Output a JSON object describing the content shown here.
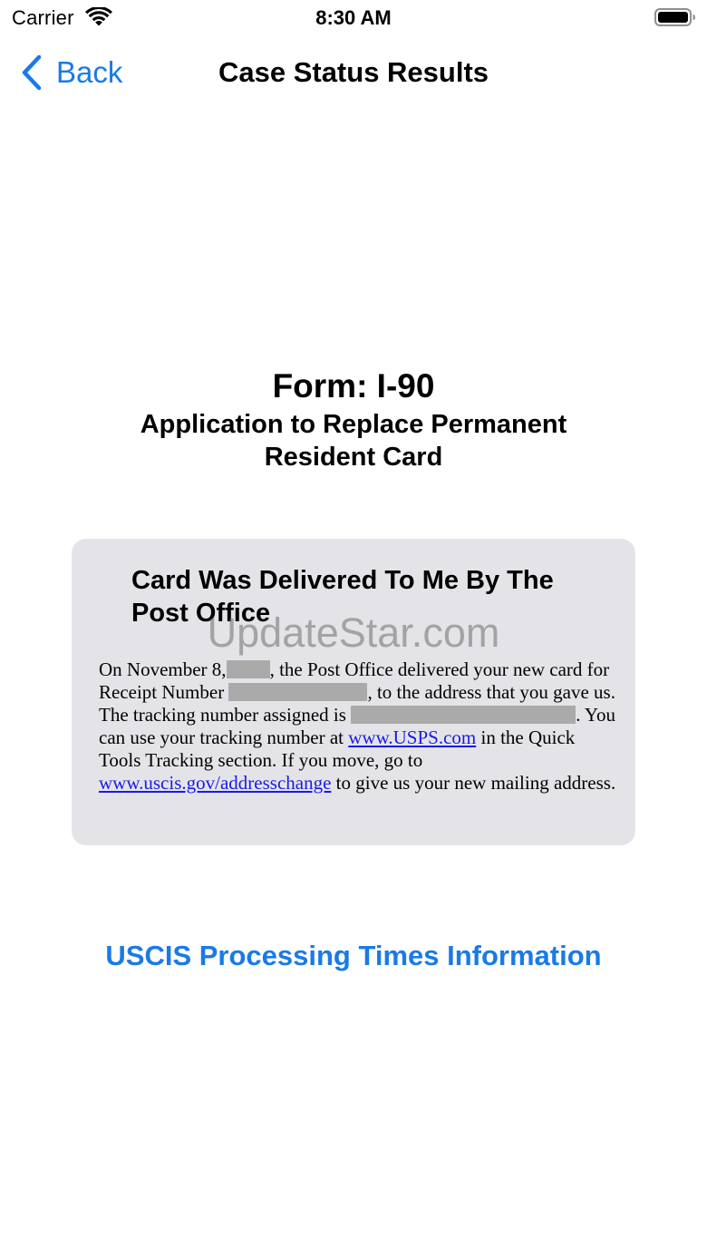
{
  "status_bar": {
    "carrier": "Carrier",
    "time": "8:30 AM",
    "wifi_icon": "wifi-icon",
    "battery_icon": "battery-icon"
  },
  "nav": {
    "back_label": "Back",
    "back_icon": "chevron-left-icon",
    "title": "Case Status Results"
  },
  "form": {
    "title": "Form: I-90",
    "subtitle": "Application to Replace Permanent Resident Card"
  },
  "status_card": {
    "heading": "Card Was Delivered To Me By The Post Office",
    "body_part1": "On November 8,",
    "body_part2": ", the Post Office delivered your new card for Receipt Number",
    "body_part3": ", to the address that you gave us. The tracking number assigned is",
    "body_part4": ". You can use your tracking number at",
    "link_usps": "www.USPS.com",
    "body_part5": "in the Quick Tools Tracking section. If you move, go to",
    "link_address_change": "www.uscis.gov/addresschange",
    "body_part6": "to give us your new mailing address."
  },
  "watermark": "UpdateStar.com",
  "processing_link": "USCIS Processing Times Information",
  "colors": {
    "accent": "#1a7ae6",
    "card_background": "#e4e4e8",
    "link": "#1a1ae6",
    "redaction": "#aaaaaa"
  }
}
